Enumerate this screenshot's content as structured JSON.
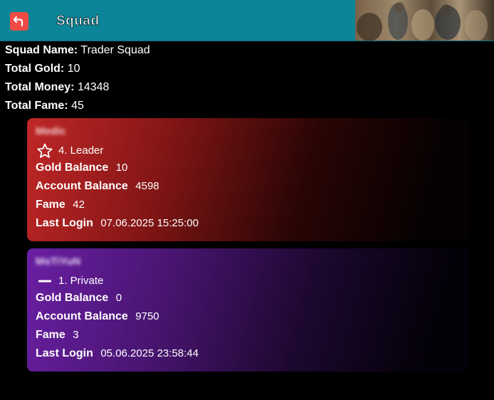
{
  "header": {
    "title": "Squad"
  },
  "summary": {
    "squad_name_label": "Squad Name:",
    "squad_name": "Trader Squad",
    "total_gold_label": "Total Gold:",
    "total_gold": "10",
    "total_money_label": "Total Money:",
    "total_money": "14348",
    "total_fame_label": "Total Fame:",
    "total_fame": "45"
  },
  "members": [
    {
      "name": "Medic",
      "rank": "4. Leader",
      "rank_icon": "star-outline-icon",
      "color": "#c02727",
      "gold_label": "Gold Balance",
      "gold": "10",
      "account_label": "Account Balance",
      "account": "4598",
      "fame_label": "Fame",
      "fame": "42",
      "login_label": "Last Login",
      "login": "07.06.2025 15:25:00"
    },
    {
      "name": "MsTiYuN",
      "rank": "1. Private",
      "rank_icon": "dash-icon",
      "color": "#6a1fa3",
      "gold_label": "Gold Balance",
      "gold": "0",
      "account_label": "Account Balance",
      "account": "9750",
      "fame_label": "Fame",
      "fame": "3",
      "login_label": "Last Login",
      "login": "05.06.2025 23:58:44"
    }
  ]
}
